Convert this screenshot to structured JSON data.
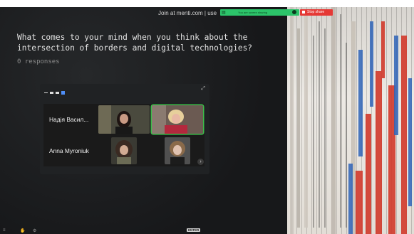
{
  "topbar": {
    "join_text": "Join at menti.com | use",
    "share_text": "You are screen sharing",
    "stop_label": "Stop share"
  },
  "slide": {
    "question": "What comes to your mind when you think about the intersection of borders and digital technologies?",
    "responses": "0 responses"
  },
  "zoom": {
    "participants": [
      {
        "name": "Надія Васил..."
      },
      {
        "name": "Anna Myroniuk"
      }
    ]
  },
  "bottom": {
    "enter_key": "ENTER"
  },
  "colors": {
    "share_green": "#2cc46a",
    "stop_red": "#e53935",
    "active_speaker": "#3bbf4a",
    "slide_bg": "#1b1d1f"
  },
  "icons": {
    "share": "screen-share-icon",
    "pin": "pin-icon",
    "stop": "stop-icon",
    "expand": "expand-icon",
    "next": "chevron-right-icon"
  }
}
